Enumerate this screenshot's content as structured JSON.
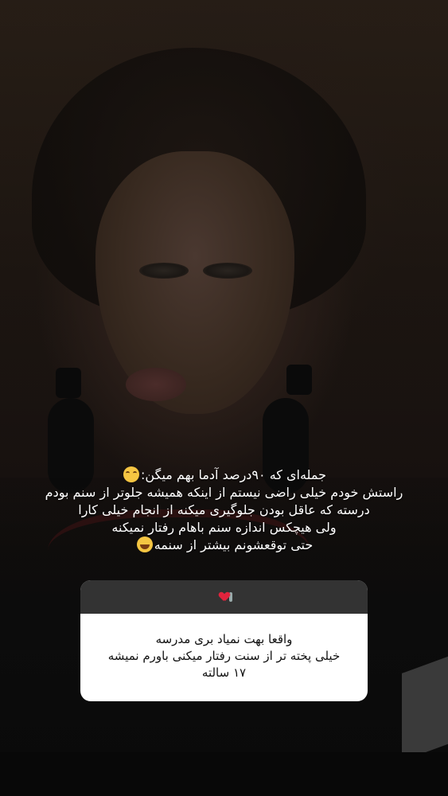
{
  "caption": {
    "lines": [
      "جمله‌ای که ۹۰درصد آدما بهم میگن:",
      "راستش خودم خیلی راضی نیستم از اینکه همیشه جلوتر از سنم بودم",
      "درسته که عاقل بودن جلوگیری میکنه از انجام خیلی کارا",
      "ولی هیچکس اندازه سنم باهام رفتار نمیکنه",
      "حتی توقعشونم بیشتر از سنمه"
    ],
    "emoji_line1": "hugging-face-emoji",
    "emoji_line5": "laughing-tears-emoji"
  },
  "question_box": {
    "header_icons": [
      "heart-with-bandage-icon",
      "person-walking-icon"
    ],
    "header_bg": "#333333",
    "body_lines": [
      "واقعا بهت نمیاد بری مدرسه",
      "خیلی پخته تر از سنت رفتار میکنی باورم نمیشه",
      "۱۷ سالته"
    ]
  },
  "colors": {
    "caption_text": "#ffffff",
    "box_body_bg": "#ffffff",
    "box_text": "#111111"
  }
}
